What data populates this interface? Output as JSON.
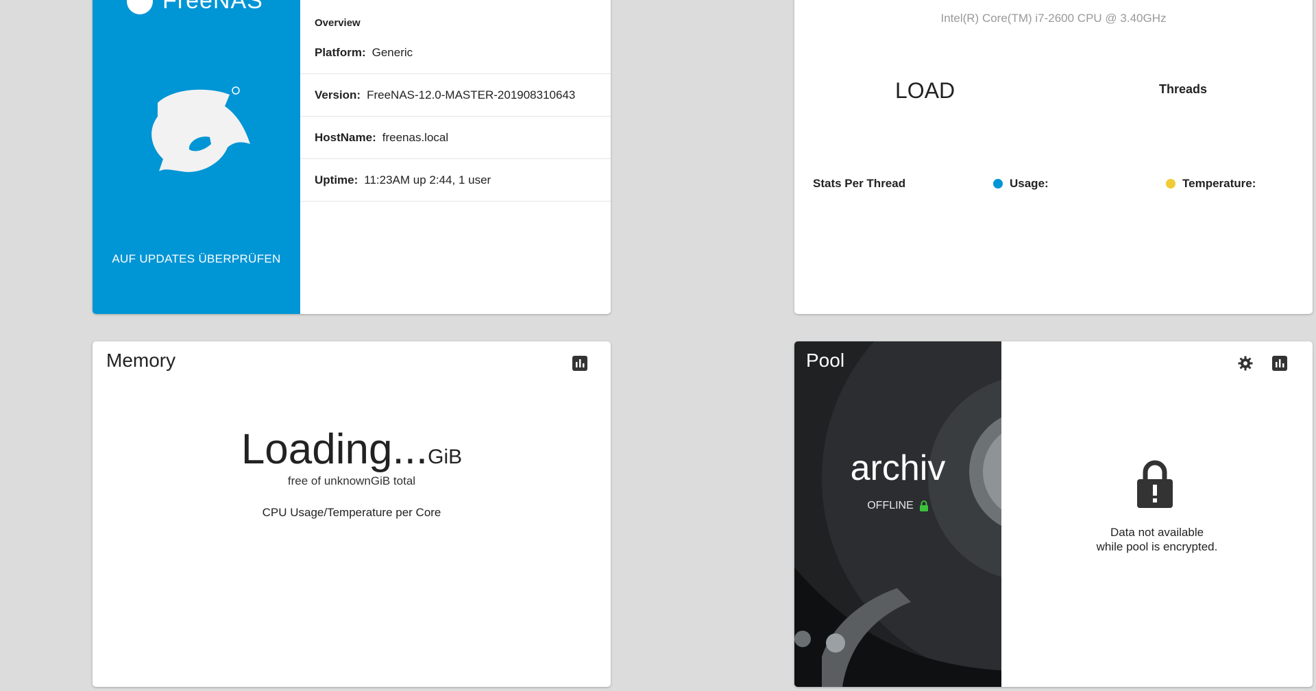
{
  "system": {
    "brand": "FreeNAS",
    "update_button": "AUF UPDATES ÜBERPRÜFEN",
    "overview_title": "Overview",
    "platform_label": "Platform:",
    "platform_value": "Generic",
    "version_label": "Version:",
    "version_value": "FreeNAS-12.0-MASTER-201908310643",
    "hostname_label": "HostName:",
    "hostname_value": "freenas.local",
    "uptime_label": "Uptime:",
    "uptime_value": "11:23AM up 2:44, 1 user"
  },
  "cpu": {
    "model": "Intel(R) Core(TM) i7-2600 CPU @ 3.40GHz",
    "load_label": "LOAD",
    "threads_label": "Threads",
    "stats_label": "Stats Per Thread",
    "legend": [
      {
        "label": "Usage:",
        "color": "#0095d5"
      },
      {
        "label": "Temperature:",
        "color": "#f0cb35"
      }
    ]
  },
  "memory": {
    "title": "Memory",
    "value": "Loading...",
    "unit": "GiB",
    "subtitle": "free of unknownGiB total",
    "cpu_label": "CPU Usage/Temperature per Core",
    "chart_icon": "bar-chart-icon"
  },
  "pool": {
    "title": "Pool",
    "name": "archiv",
    "status": "OFFLINE",
    "message_line1": "Data not available",
    "message_line2": "while pool is encrypted.",
    "icons": [
      "gear-icon",
      "bar-chart-icon"
    ]
  },
  "colors": {
    "accent": "#0095d5",
    "background": "#dcdcdc",
    "status_green": "#3cc23c",
    "temperature": "#f0cb35"
  }
}
